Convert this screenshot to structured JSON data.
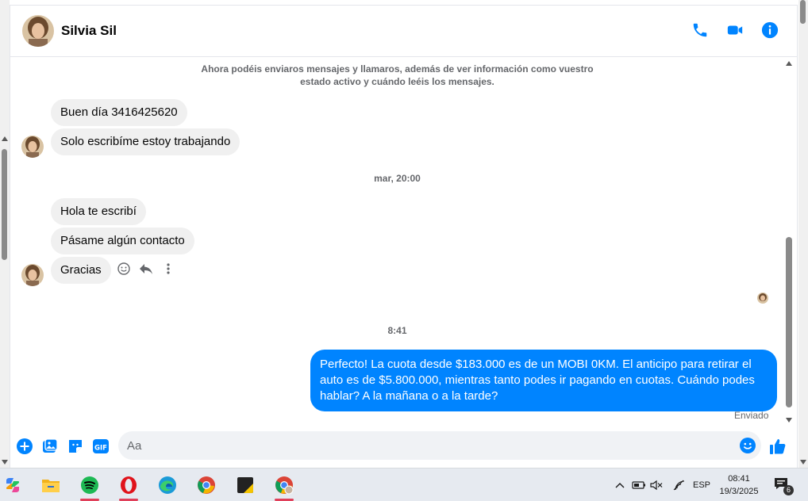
{
  "header": {
    "contact_name": "Silvia Sil",
    "actions": [
      "phone-icon",
      "video-icon",
      "info-icon"
    ]
  },
  "notice": "Ahora podéis enviaros mensajes y llamaros, además de ver información como vuestro estado activo y cuándo leéis los mensajes.",
  "messages": {
    "incoming_1": [
      "Buen día 3416425620",
      "Solo escribíme estoy trabajando"
    ],
    "timestamp_1": "mar, 20:00",
    "incoming_2": [
      "Hola te escribí",
      "Pásame algún contacto",
      "Gracias"
    ],
    "timestamp_2": "8:41",
    "outgoing": "Perfecto! La cuota desde $183.000 es de un MOBI 0KM. El anticipo para retirar el auto es de $5.800.000, mientras tanto podes ir pagando en cuotas. Cuándo podes hablar? A la mañana o a la tarde?",
    "sent_status": "Enviado"
  },
  "composer": {
    "placeholder": "Aa",
    "icons": [
      "plus-icon",
      "image-icon",
      "sticker-icon",
      "gif-icon",
      "emoji-icon",
      "thumbs-up-icon"
    ]
  },
  "colors": {
    "accent": "#0084ff",
    "incoming_bubble": "#f0f0f0",
    "header_text": "#050505"
  },
  "taskbar": {
    "apps": [
      "copilot-icon",
      "file-explorer-icon",
      "spotify-icon",
      "opera-icon",
      "edge-icon",
      "chrome-icon",
      "sticky-notes-icon",
      "chrome-profile-icon"
    ],
    "language": "ESP",
    "time": "08:41",
    "date": "19/3/2025",
    "notification_count": "6"
  }
}
